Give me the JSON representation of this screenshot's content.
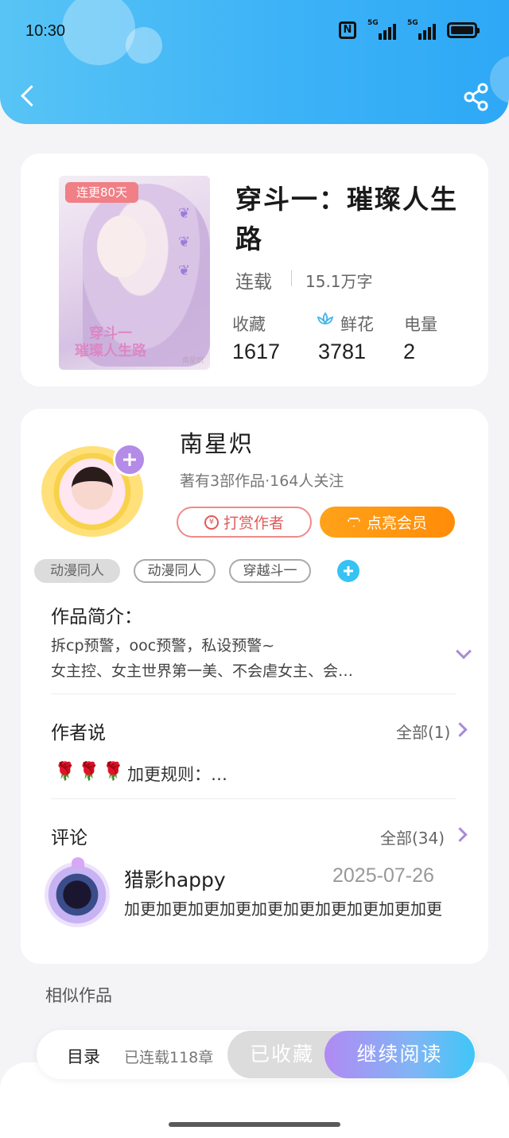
{
  "status_bar": {
    "time": "10:30",
    "nfc": "N",
    "signal1": "5G",
    "signal2": "5G"
  },
  "book": {
    "badge": "连更80天",
    "cover_title": "穿斗一\n璀璨人生路",
    "cover_author": "南星炽",
    "title": "穿斗一：璀璨人生路",
    "status": "连载",
    "word_count": "15.1万字",
    "stats": [
      {
        "label": "收藏",
        "value": "1617"
      },
      {
        "label": "鲜花",
        "value": "3781",
        "icon": "lotus-icon"
      },
      {
        "label": "电量",
        "value": "2"
      }
    ]
  },
  "author": {
    "name": "南星炽",
    "meta": "著有3部作品·164人关注",
    "reward_label": "打赏作者",
    "vip_label": "点亮会员"
  },
  "tags": [
    "动漫同人",
    "动漫同人",
    "穿越斗一"
  ],
  "intro": {
    "title": "作品简介：",
    "line1": "拆cp预警，ooc预警，私设预警~",
    "line2": "女主控、女主世界第一美、不会虐女主、会…"
  },
  "author_note": {
    "title": "作者说",
    "all_label": "全部(1)",
    "roses": "🌹🌹🌹",
    "text": "加更规则：…"
  },
  "comments": {
    "title": "评论",
    "all_label": "全部(34)",
    "items": [
      {
        "user": "猎影happy",
        "date": "2025-07-26",
        "text": "加更加更加更加更加更加更加更加更加更加更"
      }
    ]
  },
  "similar": {
    "title": "相似作品"
  },
  "bottom_bar": {
    "toc_label": "目录",
    "chapters": "已连载118章",
    "favorited_label": "已收藏",
    "continue_label": "继续阅读"
  },
  "colors": {
    "header_accent": "#3db3f7",
    "vip_orange": "#ff9812",
    "reward_red": "#e05a5a",
    "purple_accent": "#a98ad8",
    "tag_add_blue": "#36c3f3"
  }
}
